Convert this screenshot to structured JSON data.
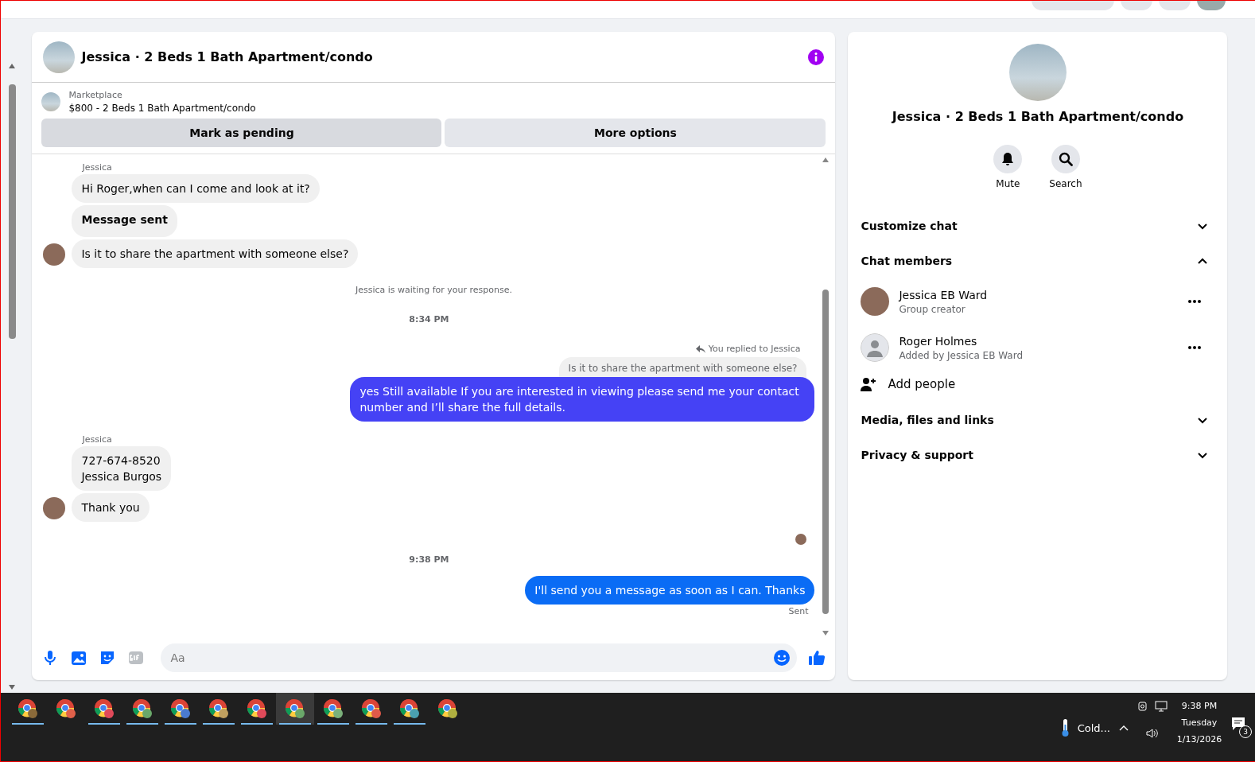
{
  "chat": {
    "title": "Jessica · 2 Beds 1 Bath Apartment/condo",
    "listing": {
      "label": "Marketplace",
      "price_title": "$800 - 2 Beds 1 Bath Apartment/condo"
    },
    "actions": [
      "Mark as pending",
      "More options"
    ],
    "messages": [
      {
        "kind": "sender",
        "text": "Jessica"
      },
      {
        "kind": "incoming",
        "text": "Hi Roger,when can I come and look at it?",
        "bold": false,
        "avatar": false
      },
      {
        "kind": "incoming",
        "text": "Message sent",
        "bold": true,
        "avatar": false
      },
      {
        "kind": "incoming",
        "text": "Is it to share the apartment with someone else?",
        "bold": false,
        "avatar": true
      },
      {
        "kind": "notice",
        "text": "Jessica is waiting for your response."
      },
      {
        "kind": "time",
        "text": "8:34 PM"
      },
      {
        "kind": "reply",
        "text": "You replied to Jessica"
      },
      {
        "kind": "quote",
        "text": "Is it to share the apartment with someone else?"
      },
      {
        "kind": "outgoing",
        "text": "yes Still available If you are interested in viewing please send me your contact number and I’ll share the full details.",
        "color": "#4542f5"
      },
      {
        "kind": "sender",
        "text": "Jessica"
      },
      {
        "kind": "incoming",
        "text": "727-674-8520\nJessica Burgos",
        "bold": false,
        "avatar": false
      },
      {
        "kind": "incoming",
        "text": "Thank you",
        "bold": false,
        "avatar": true
      },
      {
        "kind": "seen"
      },
      {
        "kind": "time",
        "text": "9:38 PM"
      },
      {
        "kind": "outgoing",
        "text": "I'll send you a message as soon as I can. Thanks",
        "color": "#0a6cf5"
      },
      {
        "kind": "status",
        "text": "Sent"
      }
    ],
    "composer": {
      "placeholder": "Aa"
    }
  },
  "details": {
    "title": "Jessica · 2 Beds 1 Bath Apartment/condo",
    "buttons": [
      {
        "kind": "mute",
        "label": "Mute"
      },
      {
        "kind": "search",
        "label": "Search"
      }
    ],
    "items": [
      {
        "kind": "section",
        "label": "Customize chat",
        "expanded": false
      },
      {
        "kind": "section",
        "label": "Chat members",
        "expanded": true
      },
      {
        "kind": "member",
        "name": "Jessica EB Ward",
        "role": "Group creator",
        "photo": true
      },
      {
        "kind": "member",
        "name": "Roger Holmes",
        "role": "Added by Jessica EB Ward",
        "photo": false
      },
      {
        "kind": "action",
        "label": "Add people"
      },
      {
        "kind": "section",
        "label": "Media, files and links",
        "expanded": false
      },
      {
        "kind": "section",
        "label": "Privacy & support",
        "expanded": false
      }
    ]
  },
  "taskbar": {
    "apps": [
      {
        "color": "#8a6a3a",
        "running": true,
        "selected": false
      },
      {
        "color": "#e0604a",
        "running": false,
        "selected": false
      },
      {
        "color": "#e04a5a",
        "running": true,
        "selected": false
      },
      {
        "color": "#6aa86a",
        "running": true,
        "selected": false
      },
      {
        "color": "#4a7ad0",
        "running": true,
        "selected": false
      },
      {
        "color": "#c0a060",
        "running": true,
        "selected": false
      },
      {
        "color": "#e04a5a",
        "running": true,
        "selected": false
      },
      {
        "color": "#6aa86a",
        "running": true,
        "selected": true
      },
      {
        "color": "#7ab07a",
        "running": true,
        "selected": false
      },
      {
        "color": "#e05a4a",
        "running": true,
        "selected": false
      },
      {
        "color": "#4aa0b0",
        "running": true,
        "selected": false
      },
      {
        "color": "#b0b040",
        "running": false,
        "selected": false
      }
    ],
    "weather": "Cold...",
    "time": "9:38 PM",
    "day": "Tuesday",
    "date": "1/13/2026",
    "notifications": "3"
  }
}
